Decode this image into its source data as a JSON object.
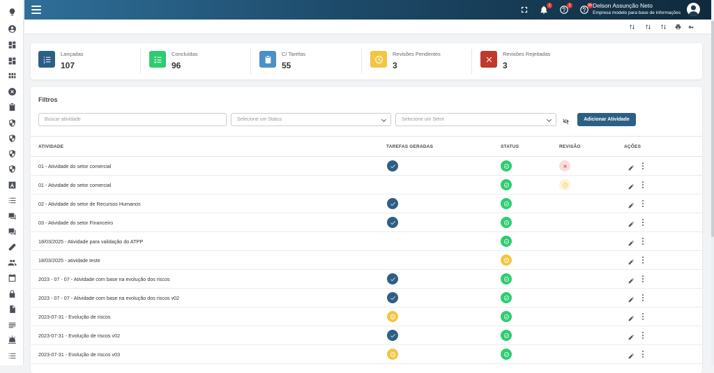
{
  "header": {
    "user_name": "Delson Assunção Neto",
    "company": "Empresa modelo para base de informações",
    "notifications": [
      {
        "icon": "bell-icon",
        "count": "1"
      },
      {
        "icon": "help-circle-icon",
        "count": "2"
      },
      {
        "icon": "help-circle-icon",
        "count": "99"
      }
    ]
  },
  "stats": [
    {
      "label": "Lançadas",
      "value": "107",
      "color": "#2d5f85",
      "icon": "list-numbered-icon"
    },
    {
      "label": "Concluídas",
      "value": "96",
      "color": "#2ecc71",
      "icon": "checklist-icon"
    },
    {
      "label": "C/ Tarefas",
      "value": "55",
      "color": "#4a90c9",
      "icon": "clipboard-check-icon"
    },
    {
      "label": "Revisões Pendentes",
      "value": "3",
      "color": "#f4c542",
      "icon": "clock-icon"
    },
    {
      "label": "Revisões Rejeitadas",
      "value": "3",
      "color": "#c0392b",
      "icon": "close-icon"
    }
  ],
  "filters": {
    "title": "Filtros",
    "search_placeholder": "Buscar atividade",
    "status_placeholder": "Selecione um Status",
    "sector_placeholder": "Selecione um Setor",
    "add_button": "Adicionar Atividade"
  },
  "table": {
    "headers": {
      "activity": "ATIVIDADE",
      "tasks": "TAREFAS GERADAS",
      "status": "STATUS",
      "review": "REVISÃO",
      "actions": "AÇÕES"
    },
    "rows": [
      {
        "name": "01 - Atividade do setor comercial",
        "tasks": "check",
        "status": "done",
        "review": "rejected"
      },
      {
        "name": "01 - Atividade do setor comercial",
        "tasks": "",
        "status": "done",
        "review": "pending"
      },
      {
        "name": "02 - Atividade do setor de Recursos Humanos",
        "tasks": "check",
        "status": "done",
        "review": ""
      },
      {
        "name": "03 - Atividade do setor Financeiro",
        "tasks": "check",
        "status": "done",
        "review": ""
      },
      {
        "name": "18/03/2025 - Atividade para validação do ATPP",
        "tasks": "",
        "status": "done",
        "review": ""
      },
      {
        "name": "18/03/2025 - atividade teste",
        "tasks": "",
        "status": "pending",
        "review": ""
      },
      {
        "name": "2023 - 07 - 07 - Atividade com base na evolução dos riscos",
        "tasks": "check",
        "status": "done",
        "review": ""
      },
      {
        "name": "2023 - 07 - 07 - Atividade com base na evolução dos riscos v02",
        "tasks": "check",
        "status": "done",
        "review": ""
      },
      {
        "name": "2023-07-31 - Evolução de riscos",
        "tasks": "pending",
        "status": "done",
        "review": ""
      },
      {
        "name": "2023-07-31 - Evolução de riscos v02",
        "tasks": "check",
        "status": "done",
        "review": ""
      },
      {
        "name": "2023-07-31 - Evolução de riscos v03",
        "tasks": "pending",
        "status": "done",
        "review": ""
      }
    ]
  },
  "sidebar_icons": [
    "lightbulb-icon",
    "account-icon",
    "dashboard-icon",
    "dashboard-icon",
    "grid-icon",
    "close-circle-icon",
    "clipboard-icon",
    "shield-icon",
    "shield-icon",
    "shield-icon",
    "shield-icon",
    "font-icon",
    "list-icon",
    "forum-icon",
    "forum-icon",
    "bandage-icon",
    "people-icon",
    "calendar-icon",
    "lock-icon",
    "file-icon",
    "text-icon",
    "alarm-icon",
    "list-icon"
  ]
}
